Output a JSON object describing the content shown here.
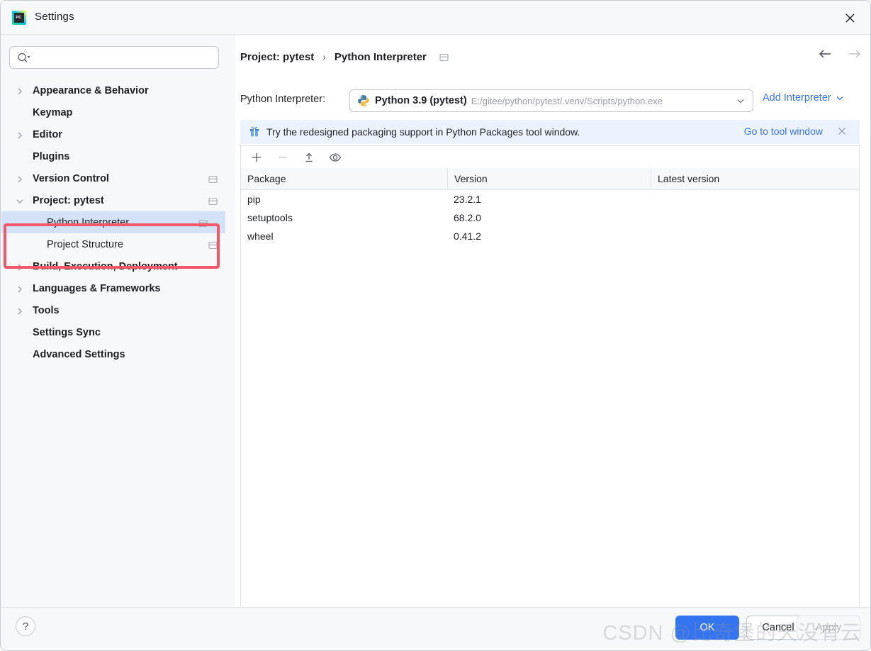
{
  "window": {
    "title": "Settings",
    "logo_icon": "pycharm-logo-icon",
    "close_icon": "close-icon"
  },
  "sidebar": {
    "search": {
      "value": "",
      "placeholder": "",
      "icon": "search-icon"
    },
    "items": [
      {
        "label": "Appearance & Behavior",
        "indent": 0,
        "bold": true,
        "expandable": true,
        "expanded": false,
        "scope_icon": false,
        "selected": false
      },
      {
        "label": "Keymap",
        "indent": 0,
        "bold": true,
        "expandable": false,
        "expanded": false,
        "scope_icon": false,
        "selected": false
      },
      {
        "label": "Editor",
        "indent": 0,
        "bold": true,
        "expandable": true,
        "expanded": false,
        "scope_icon": false,
        "selected": false
      },
      {
        "label": "Plugins",
        "indent": 0,
        "bold": true,
        "expandable": false,
        "expanded": false,
        "scope_icon": false,
        "selected": false
      },
      {
        "label": "Version Control",
        "indent": 0,
        "bold": true,
        "expandable": true,
        "expanded": false,
        "scope_icon": true,
        "selected": false
      },
      {
        "label": "Project: pytest",
        "indent": 0,
        "bold": true,
        "expandable": true,
        "expanded": true,
        "scope_icon": true,
        "selected": false
      },
      {
        "label": "Python Interpreter",
        "indent": 1,
        "bold": false,
        "expandable": false,
        "expanded": false,
        "scope_icon": true,
        "selected": true
      },
      {
        "label": "Project Structure",
        "indent": 1,
        "bold": false,
        "expandable": false,
        "expanded": false,
        "scope_icon": true,
        "selected": false
      },
      {
        "label": "Build, Execution, Deployment",
        "indent": 0,
        "bold": true,
        "expandable": true,
        "expanded": false,
        "scope_icon": false,
        "selected": false
      },
      {
        "label": "Languages & Frameworks",
        "indent": 0,
        "bold": true,
        "expandable": true,
        "expanded": false,
        "scope_icon": false,
        "selected": false
      },
      {
        "label": "Tools",
        "indent": 0,
        "bold": true,
        "expandable": true,
        "expanded": false,
        "scope_icon": false,
        "selected": false
      },
      {
        "label": "Settings Sync",
        "indent": 0,
        "bold": true,
        "expandable": false,
        "expanded": false,
        "scope_icon": false,
        "selected": false
      },
      {
        "label": "Advanced Settings",
        "indent": 0,
        "bold": true,
        "expandable": false,
        "expanded": false,
        "scope_icon": false,
        "selected": false
      }
    ],
    "annotation_color": "#f4566a",
    "selection_color": "#d4e2f7"
  },
  "main": {
    "breadcrumb": {
      "parent": "Project: pytest",
      "separator": "›",
      "current": "Python Interpreter",
      "scope_icon": "project-scope-icon"
    },
    "nav": {
      "back_icon": "arrow-left-icon",
      "forward_icon": "arrow-right-icon"
    },
    "interpreter": {
      "label": "Python Interpreter:",
      "icon": "python-venv-icon",
      "name": "Python 3.9 (pytest)",
      "path": "E:/gitee/python/pytest/.venv/Scripts/python.exe",
      "dropdown_icon": "chevron-down-icon",
      "add_label": "Add Interpreter",
      "add_chevron_icon": "chevron-down-icon",
      "link_color": "#3574f0"
    },
    "banner": {
      "icon": "gift-icon",
      "text": "Try the redesigned packaging support in Python Packages tool window.",
      "link": "Go to tool window",
      "close_icon": "close-icon",
      "background": "#edf3fe"
    },
    "toolbar": [
      {
        "name": "add-package-button",
        "icon": "plus-icon",
        "enabled": true
      },
      {
        "name": "remove-package-button",
        "icon": "minus-icon",
        "enabled": false
      },
      {
        "name": "upgrade-package-button",
        "icon": "upload-icon",
        "enabled": true
      },
      {
        "name": "show-early-releases-button",
        "icon": "eye-icon",
        "enabled": true
      }
    ],
    "packages_table": {
      "columns": [
        "Package",
        "Version",
        "Latest version"
      ],
      "rows": [
        {
          "package": "pip",
          "version": "23.2.1",
          "latest": ""
        },
        {
          "package": "setuptools",
          "version": "68.2.0",
          "latest": ""
        },
        {
          "package": "wheel",
          "version": "0.41.2",
          "latest": ""
        }
      ]
    }
  },
  "footer": {
    "help_label": "?",
    "ok_label": "OK",
    "cancel_label": "Cancel",
    "apply_label": "Apply"
  },
  "watermark": "CSDN @比奇堡的天没有云"
}
